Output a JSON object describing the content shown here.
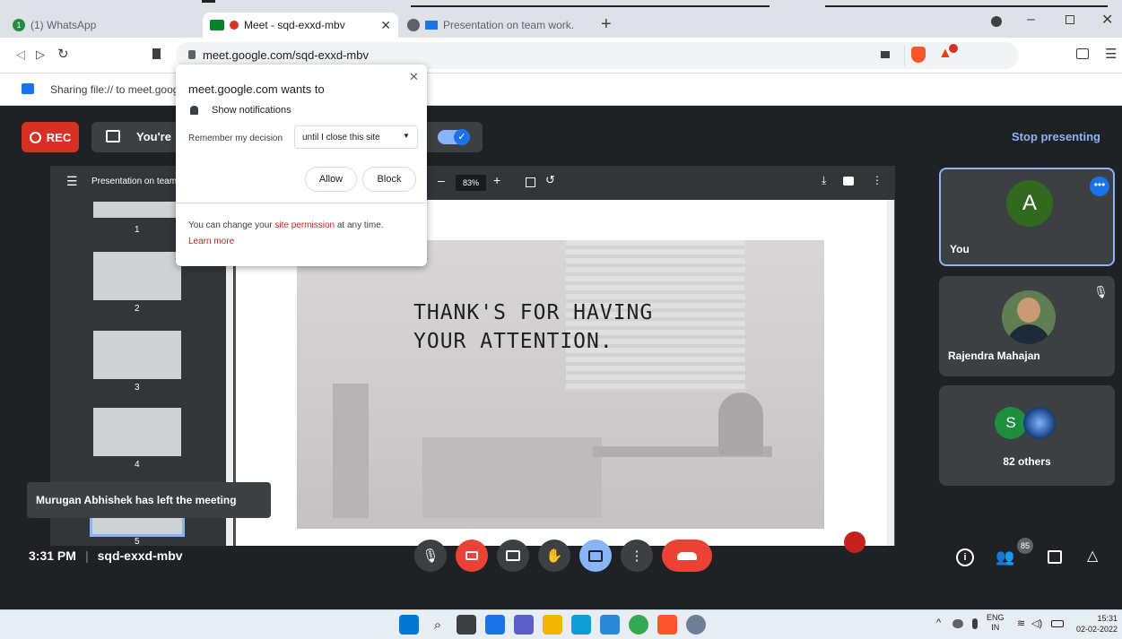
{
  "tabs": [
    {
      "label": "(1) WhatsApp"
    },
    {
      "label": "Meet - sqd-exxd-mbv"
    },
    {
      "label": "Presentation on team work."
    }
  ],
  "address": {
    "url": "meet.google.com/sqd-exxd-mbv"
  },
  "share_bar": {
    "text": "Sharing file:// to meet.goog"
  },
  "popup": {
    "title": "meet.google.com wants to",
    "permission": "Show notifications",
    "remember_label": "Remember my decision",
    "remember_value": "until I close this site",
    "allow": "Allow",
    "block": "Block",
    "footer_prefix": "You can change your ",
    "footer_link": "site permission",
    "footer_suffix": " at any time.",
    "learn_more": "Learn more"
  },
  "meet": {
    "rec": "REC",
    "presenting_text": "You're",
    "stop_presenting": "Stop presenting",
    "time": "3:31 PM",
    "meeting_code": "sqd-exxd-mbv",
    "people_count": "85",
    "toast": "Murugan Abhishek has left the meeting"
  },
  "pdf": {
    "title": "Presentation on team",
    "zoom": "83%",
    "slide_text_line1": "THANK'S FOR HAVING",
    "slide_text_line2": "YOUR ATTENTION.",
    "thumbs": [
      "1",
      "2",
      "3",
      "4",
      "5"
    ]
  },
  "participants": [
    {
      "initial": "A",
      "name": "You",
      "avatar_color": "#33691e"
    },
    {
      "name": "Rajendra Mahajan"
    },
    {
      "initial": "S",
      "name": "82 others",
      "avatar_color": "#1e8e3e"
    }
  ],
  "taskbar": {
    "lang1": "ENG",
    "lang2": "IN",
    "time": "15:31",
    "date": "02-02-2022"
  },
  "colors": {
    "rec": "#d93025",
    "accent": "#8ab4f8",
    "end_call": "#ea4335",
    "link": "#c5221f"
  }
}
